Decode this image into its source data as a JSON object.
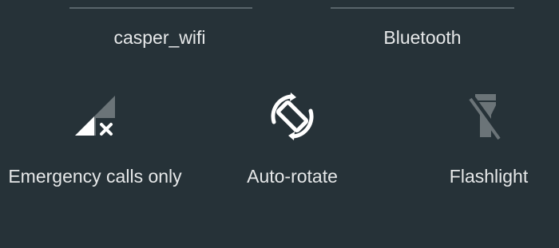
{
  "quick_settings": {
    "top_tiles": [
      {
        "label": "casper_wifi"
      },
      {
        "label": "Bluetooth"
      }
    ],
    "tiles": [
      {
        "label": "Emergency calls only",
        "icon": "signal-no-service-icon"
      },
      {
        "label": "Auto-rotate",
        "icon": "auto-rotate-icon"
      },
      {
        "label": "Flashlight",
        "icon": "flashlight-off-icon"
      }
    ]
  },
  "colors": {
    "background": "#263238",
    "text": "#e6e8e9",
    "divider": "#59656b",
    "icon_active": "#ffffff",
    "icon_inactive": "#6b7478"
  }
}
